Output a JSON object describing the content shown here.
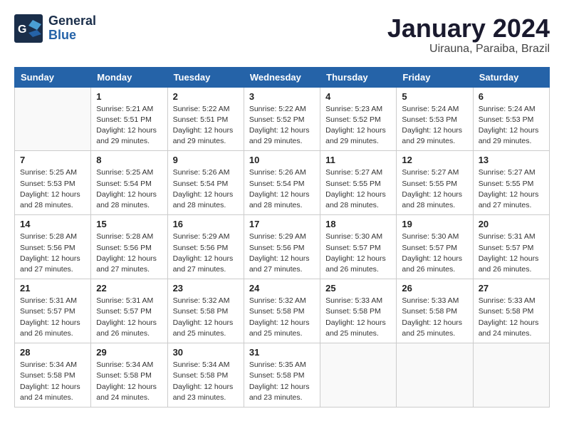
{
  "header": {
    "logo_general": "General",
    "logo_blue": "Blue",
    "month_title": "January 2024",
    "location": "Uirauna, Paraiba, Brazil"
  },
  "weekdays": [
    "Sunday",
    "Monday",
    "Tuesday",
    "Wednesday",
    "Thursday",
    "Friday",
    "Saturday"
  ],
  "weeks": [
    [
      {
        "day": "",
        "details": ""
      },
      {
        "day": "1",
        "details": "Sunrise: 5:21 AM\nSunset: 5:51 PM\nDaylight: 12 hours\nand 29 minutes."
      },
      {
        "day": "2",
        "details": "Sunrise: 5:22 AM\nSunset: 5:51 PM\nDaylight: 12 hours\nand 29 minutes."
      },
      {
        "day": "3",
        "details": "Sunrise: 5:22 AM\nSunset: 5:52 PM\nDaylight: 12 hours\nand 29 minutes."
      },
      {
        "day": "4",
        "details": "Sunrise: 5:23 AM\nSunset: 5:52 PM\nDaylight: 12 hours\nand 29 minutes."
      },
      {
        "day": "5",
        "details": "Sunrise: 5:24 AM\nSunset: 5:53 PM\nDaylight: 12 hours\nand 29 minutes."
      },
      {
        "day": "6",
        "details": "Sunrise: 5:24 AM\nSunset: 5:53 PM\nDaylight: 12 hours\nand 29 minutes."
      }
    ],
    [
      {
        "day": "7",
        "details": "Sunrise: 5:25 AM\nSunset: 5:53 PM\nDaylight: 12 hours\nand 28 minutes."
      },
      {
        "day": "8",
        "details": "Sunrise: 5:25 AM\nSunset: 5:54 PM\nDaylight: 12 hours\nand 28 minutes."
      },
      {
        "day": "9",
        "details": "Sunrise: 5:26 AM\nSunset: 5:54 PM\nDaylight: 12 hours\nand 28 minutes."
      },
      {
        "day": "10",
        "details": "Sunrise: 5:26 AM\nSunset: 5:54 PM\nDaylight: 12 hours\nand 28 minutes."
      },
      {
        "day": "11",
        "details": "Sunrise: 5:27 AM\nSunset: 5:55 PM\nDaylight: 12 hours\nand 28 minutes."
      },
      {
        "day": "12",
        "details": "Sunrise: 5:27 AM\nSunset: 5:55 PM\nDaylight: 12 hours\nand 28 minutes."
      },
      {
        "day": "13",
        "details": "Sunrise: 5:27 AM\nSunset: 5:55 PM\nDaylight: 12 hours\nand 27 minutes."
      }
    ],
    [
      {
        "day": "14",
        "details": "Sunrise: 5:28 AM\nSunset: 5:56 PM\nDaylight: 12 hours\nand 27 minutes."
      },
      {
        "day": "15",
        "details": "Sunrise: 5:28 AM\nSunset: 5:56 PM\nDaylight: 12 hours\nand 27 minutes."
      },
      {
        "day": "16",
        "details": "Sunrise: 5:29 AM\nSunset: 5:56 PM\nDaylight: 12 hours\nand 27 minutes."
      },
      {
        "day": "17",
        "details": "Sunrise: 5:29 AM\nSunset: 5:56 PM\nDaylight: 12 hours\nand 27 minutes."
      },
      {
        "day": "18",
        "details": "Sunrise: 5:30 AM\nSunset: 5:57 PM\nDaylight: 12 hours\nand 26 minutes."
      },
      {
        "day": "19",
        "details": "Sunrise: 5:30 AM\nSunset: 5:57 PM\nDaylight: 12 hours\nand 26 minutes."
      },
      {
        "day": "20",
        "details": "Sunrise: 5:31 AM\nSunset: 5:57 PM\nDaylight: 12 hours\nand 26 minutes."
      }
    ],
    [
      {
        "day": "21",
        "details": "Sunrise: 5:31 AM\nSunset: 5:57 PM\nDaylight: 12 hours\nand 26 minutes."
      },
      {
        "day": "22",
        "details": "Sunrise: 5:31 AM\nSunset: 5:57 PM\nDaylight: 12 hours\nand 26 minutes."
      },
      {
        "day": "23",
        "details": "Sunrise: 5:32 AM\nSunset: 5:58 PM\nDaylight: 12 hours\nand 25 minutes."
      },
      {
        "day": "24",
        "details": "Sunrise: 5:32 AM\nSunset: 5:58 PM\nDaylight: 12 hours\nand 25 minutes."
      },
      {
        "day": "25",
        "details": "Sunrise: 5:33 AM\nSunset: 5:58 PM\nDaylight: 12 hours\nand 25 minutes."
      },
      {
        "day": "26",
        "details": "Sunrise: 5:33 AM\nSunset: 5:58 PM\nDaylight: 12 hours\nand 25 minutes."
      },
      {
        "day": "27",
        "details": "Sunrise: 5:33 AM\nSunset: 5:58 PM\nDaylight: 12 hours\nand 24 minutes."
      }
    ],
    [
      {
        "day": "28",
        "details": "Sunrise: 5:34 AM\nSunset: 5:58 PM\nDaylight: 12 hours\nand 24 minutes."
      },
      {
        "day": "29",
        "details": "Sunrise: 5:34 AM\nSunset: 5:58 PM\nDaylight: 12 hours\nand 24 minutes."
      },
      {
        "day": "30",
        "details": "Sunrise: 5:34 AM\nSunset: 5:58 PM\nDaylight: 12 hours\nand 23 minutes."
      },
      {
        "day": "31",
        "details": "Sunrise: 5:35 AM\nSunset: 5:58 PM\nDaylight: 12 hours\nand 23 minutes."
      },
      {
        "day": "",
        "details": ""
      },
      {
        "day": "",
        "details": ""
      },
      {
        "day": "",
        "details": ""
      }
    ]
  ]
}
